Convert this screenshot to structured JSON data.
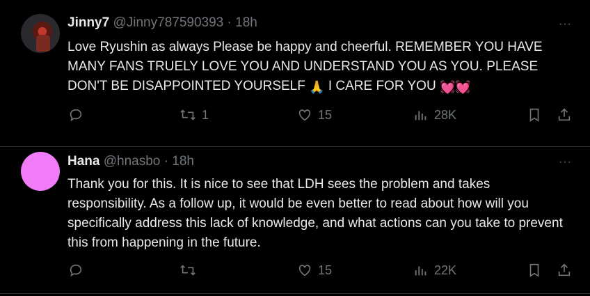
{
  "tweets": [
    {
      "name": "Jinny7",
      "handle": "@Jinny787590393",
      "time": "18h",
      "text_main": "Love Ryushin as always Please be happy and cheerful. REMEMBER YOU HAVE MANY FANS TRUELY LOVE YOU AND UNDERSTAND YOU AS YOU. PLEASE DON'T BE DISAPPOINTED YOURSELF",
      "text_tail": "I CARE FOR YOU",
      "emoji_pray": "🙏",
      "emoji_hearts": "💓💓",
      "replies": "",
      "retweets": "1",
      "likes": "15",
      "views": "28K",
      "avatar_icon": "profile-photo"
    },
    {
      "name": "Hana",
      "handle": "@hnasbo",
      "time": "18h",
      "text": "Thank you for this. It is nice to see that LDH sees the problem and takes responsibility. As a follow up, it would be even better to read about how will you specifically address this lack of knowledge, and what actions can you take to prevent this from happening in the future.",
      "replies": "",
      "retweets": "",
      "likes": "15",
      "views": "22K",
      "avatar_color": "#f07df7"
    }
  ],
  "separator": "·",
  "more_label": "···",
  "colors": {
    "background": "#000000",
    "text": "#e7e9ea",
    "muted": "#71767b",
    "divider": "#2f3336"
  }
}
